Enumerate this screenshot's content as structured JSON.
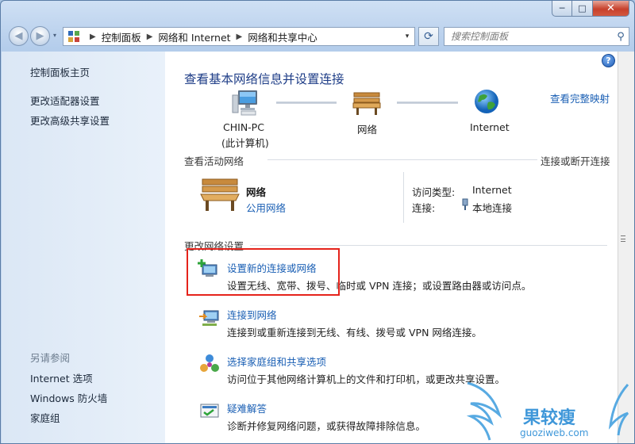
{
  "window": {
    "caption": {
      "minimize": "─",
      "maximize": "□",
      "close": "✕"
    }
  },
  "address_bar": {
    "back_glyph": "◀",
    "forward_glyph": "▶",
    "recent_glyph": "▾",
    "breadcrumbs": [
      "控制面板",
      "网络和 Internet",
      "网络和共享中心"
    ],
    "separator": "▶",
    "dropdown_glyph": "▾",
    "refresh_glyph": "⟳",
    "search_placeholder": "搜索控制面板",
    "search_glyph": "⚲"
  },
  "sidebar": {
    "links": [
      "控制面板主页",
      "更改适配器设置",
      "更改高级共享设置"
    ],
    "see_also_label": "另请参阅",
    "see_also_links": [
      "Internet 选项",
      "Windows 防火墙",
      "家庭组"
    ]
  },
  "main": {
    "help_glyph": "?",
    "title": "查看基本网络信息并设置连接",
    "full_map_link": "查看完整映射",
    "map_nodes": [
      {
        "label": "CHIN-PC",
        "sublabel": "(此计算机)",
        "icon": "computer-icon"
      },
      {
        "label": "网络",
        "icon": "network-bench-icon"
      },
      {
        "label": "Internet",
        "icon": "globe-icon"
      }
    ],
    "active_networks_header": "查看活动网络",
    "connect_disconnect_link": "连接或断开连接",
    "active_network": {
      "name": "网络",
      "type_link": "公用网络",
      "access_type_label": "访问类型:",
      "access_type_value": "Internet",
      "connections_label": "连接:",
      "connection_link": "本地连接"
    },
    "change_settings_header": "更改网络设置",
    "tasks": [
      {
        "title": "设置新的连接或网络",
        "desc": "设置无线、宽带、拨号、临时或 VPN 连接；或设置路由器或访问点。",
        "icon": "new-connection-icon"
      },
      {
        "title": "连接到网络",
        "desc": "连接到或重新连接到无线、有线、拨号或 VPN 网络连接。",
        "icon": "connect-network-icon"
      },
      {
        "title": "选择家庭组和共享选项",
        "desc": "访问位于其他网络计算机上的文件和打印机，或更改共享设置。",
        "icon": "homegroup-icon"
      },
      {
        "title": "疑难解答",
        "desc": "诊断并修复网络问题，或获得故障排除信息。",
        "icon": "troubleshoot-icon"
      }
    ]
  },
  "watermark": {
    "brand": "果较瘦",
    "url": "guoziweb.com"
  },
  "colors": {
    "link": "#1a5fb4",
    "title": "#1e3d87",
    "highlight_box": "#e5231b",
    "sidebar": "#dbe7f5"
  }
}
